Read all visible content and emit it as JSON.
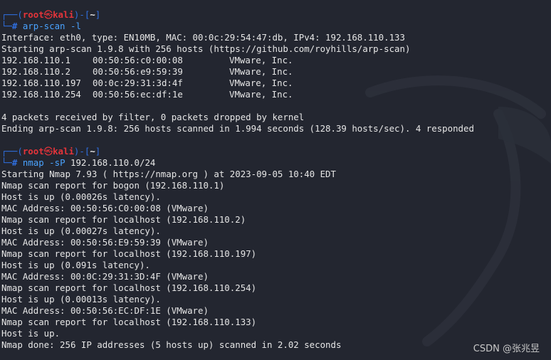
{
  "prompt": {
    "user": "root",
    "at_symbol": "㉿",
    "host": "kali",
    "cwd": "~"
  },
  "blocks": [
    {
      "command": "arp-scan",
      "args": "-l",
      "output": [
        "Interface: eth0, type: EN10MB, MAC: 00:0c:29:54:47:db, IPv4: 192.168.110.133",
        "Starting arp-scan 1.9.8 with 256 hosts (https://github.com/royhills/arp-scan)"
      ],
      "table": [
        {
          "ip": "192.168.110.1",
          "mac": "00:50:56:c0:00:08",
          "vendor": "VMware, Inc."
        },
        {
          "ip": "192.168.110.2",
          "mac": "00:50:56:e9:59:39",
          "vendor": "VMware, Inc."
        },
        {
          "ip": "192.168.110.197",
          "mac": "00:0c:29:31:3d:4f",
          "vendor": "VMware, Inc."
        },
        {
          "ip": "192.168.110.254",
          "mac": "00:50:56:ec:df:1e",
          "vendor": "VMware, Inc."
        }
      ],
      "footer": [
        "4 packets received by filter, 0 packets dropped by kernel",
        "Ending arp-scan 1.9.8: 256 hosts scanned in 1.994 seconds (128.39 hosts/sec). 4 responded"
      ]
    },
    {
      "command": "nmap",
      "args": "-sP",
      "target": "192.168.110.0/24",
      "output": [
        "Starting Nmap 7.93 ( https://nmap.org ) at 2023-09-05 10:40 EDT",
        "Nmap scan report for bogon (192.168.110.1)",
        "Host is up (0.00026s latency).",
        "MAC Address: 00:50:56:C0:00:08 (VMware)",
        "Nmap scan report for localhost (192.168.110.2)",
        "Host is up (0.00027s latency).",
        "MAC Address: 00:50:56:E9:59:39 (VMware)",
        "Nmap scan report for localhost (192.168.110.197)",
        "Host is up (0.091s latency).",
        "MAC Address: 00:0C:29:31:3D:4F (VMware)",
        "Nmap scan report for localhost (192.168.110.254)",
        "Host is up (0.00013s latency).",
        "MAC Address: 00:50:56:EC:DF:1E (VMware)",
        "Nmap scan report for localhost (192.168.110.133)",
        "Host is up.",
        "Nmap done: 256 IP addresses (5 hosts up) scanned in 2.02 seconds"
      ]
    }
  ],
  "watermark": "CSDN @张兆昱",
  "colors": {
    "background": "#232630",
    "prompt_blue": "#2f6fe0",
    "prompt_red": "#e5343a",
    "command_blue": "#4aa3ff",
    "text": "#e6e6e6"
  }
}
